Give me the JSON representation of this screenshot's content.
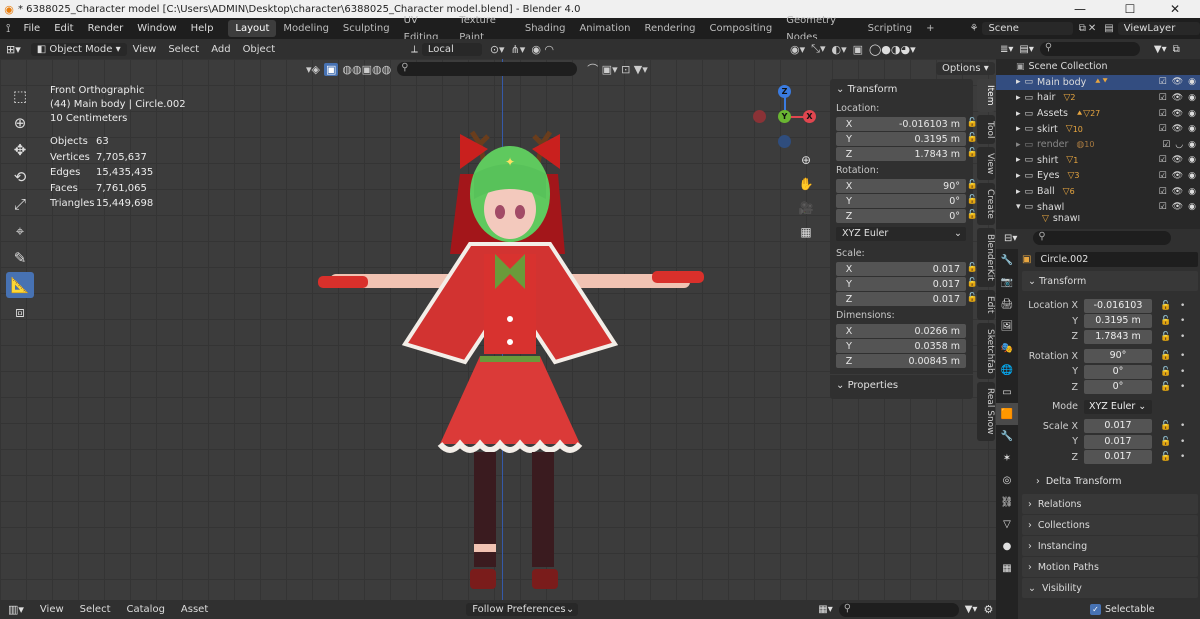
{
  "window": {
    "title": "* 6388025_Character model [C:\\Users\\ADMIN\\Desktop\\character\\6388025_Character model.blend] - Blender 4.0",
    "minimize": "—",
    "maximize": "☐",
    "close": "✕"
  },
  "menu": [
    "File",
    "Edit",
    "Render",
    "Window",
    "Help"
  ],
  "workspaces": [
    "Layout",
    "Modeling",
    "Sculpting",
    "UV Editing",
    "Texture Paint",
    "Shading",
    "Animation",
    "Rendering",
    "Compositing",
    "Geometry Nodes",
    "Scripting"
  ],
  "scene": {
    "label": "Scene",
    "view_layer": "ViewLayer"
  },
  "viewport_header": {
    "mode": "Object Mode",
    "menus": [
      "View",
      "Select",
      "Add",
      "Object"
    ],
    "orientation": "Local",
    "options": "Options"
  },
  "overlay": {
    "view": "Front Orthographic",
    "object": "(44) Main body | Circle.002",
    "scale": "10 Centimeters"
  },
  "stats": [
    {
      "k": "Objects",
      "v": "63"
    },
    {
      "k": "Vertices",
      "v": "7,705,637"
    },
    {
      "k": "Edges",
      "v": "15,435,435"
    },
    {
      "k": "Faces",
      "v": "7,761,065"
    },
    {
      "k": "Triangles",
      "v": "15,449,698"
    }
  ],
  "gizmo": {
    "x": "X",
    "y": "Y",
    "z": "Z"
  },
  "npanel": {
    "transform": "Transform",
    "location_label": "Location:",
    "location": [
      {
        "ax": "X",
        "v": "-0.016103 m"
      },
      {
        "ax": "Y",
        "v": "0.3195 m"
      },
      {
        "ax": "Z",
        "v": "1.7843 m"
      }
    ],
    "rotation_label": "Rotation:",
    "rotation": [
      {
        "ax": "X",
        "v": "90°"
      },
      {
        "ax": "Y",
        "v": "0°"
      },
      {
        "ax": "Z",
        "v": "0°"
      }
    ],
    "rotation_mode": "XYZ Euler",
    "scale_label": "Scale:",
    "scale": [
      {
        "ax": "X",
        "v": "0.017"
      },
      {
        "ax": "Y",
        "v": "0.017"
      },
      {
        "ax": "Z",
        "v": "0.017"
      }
    ],
    "dimensions_label": "Dimensions:",
    "dimensions": [
      {
        "ax": "X",
        "v": "0.0266 m"
      },
      {
        "ax": "Y",
        "v": "0.0358 m"
      },
      {
        "ax": "Z",
        "v": "0.00845 m"
      }
    ],
    "properties": "Properties"
  },
  "side_tabs": [
    "Item",
    "Tool",
    "View",
    "Create",
    "BlenderKit",
    "Edit",
    "Sketchfab",
    "Real Snow"
  ],
  "outliner": {
    "root": "Scene Collection",
    "items": [
      {
        "name": "Main body",
        "badge": "",
        "selected": true
      },
      {
        "name": "hair",
        "badge": "2",
        "selected": false
      },
      {
        "name": "Assets",
        "badge": "27",
        "selected": false
      },
      {
        "name": "skirt",
        "badge": "10",
        "selected": false
      },
      {
        "name": "render",
        "badge": "10",
        "selected": false
      },
      {
        "name": "shirt",
        "badge": "1",
        "selected": false
      },
      {
        "name": "Eyes",
        "badge": "3",
        "selected": false
      },
      {
        "name": "Ball",
        "badge": "6",
        "selected": false
      },
      {
        "name": "shawl",
        "badge": "",
        "selected": false
      },
      {
        "name": "shawl",
        "badge": "",
        "selected": false
      }
    ]
  },
  "properties": {
    "object_name": "Circle.002",
    "transform": "Transform",
    "location": [
      {
        "l": "Location X",
        "v": "-0.016103"
      },
      {
        "l": "Y",
        "v": "0.3195 m"
      },
      {
        "l": "Z",
        "v": "1.7843 m"
      }
    ],
    "rotation": [
      {
        "l": "Rotation X",
        "v": "90°"
      },
      {
        "l": "Y",
        "v": "0°"
      },
      {
        "l": "Z",
        "v": "0°"
      }
    ],
    "mode_label": "Mode",
    "mode_value": "XYZ Euler",
    "scale": [
      {
        "l": "Scale X",
        "v": "0.017"
      },
      {
        "l": "Y",
        "v": "0.017"
      },
      {
        "l": "Z",
        "v": "0.017"
      }
    ],
    "delta": "Delta Transform",
    "sections": [
      "Relations",
      "Collections",
      "Instancing",
      "Motion Paths",
      "Visibility"
    ],
    "selectable": "Selectable"
  },
  "bottom": {
    "menus": [
      "View",
      "Select",
      "Catalog",
      "Asset"
    ],
    "follow": "Follow Preferences"
  },
  "colors": {
    "accent": "#4772b3",
    "selected_row": "#334d80",
    "x_axis": "#e0464f",
    "y_axis": "#6ab532",
    "z_axis": "#3a7be0"
  }
}
